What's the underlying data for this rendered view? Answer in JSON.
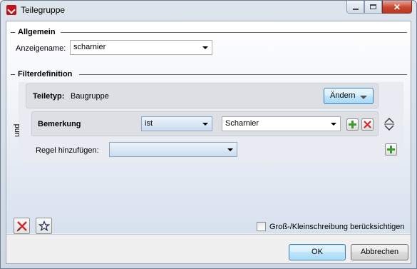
{
  "window": {
    "title": "Teilegruppe"
  },
  "allgemein": {
    "section_title": "Allgemein",
    "anzeigename_label": "Anzeigename:",
    "anzeigename_value": "scharnier"
  },
  "filter": {
    "section_title": "Filterdefinition",
    "connector_label": "und",
    "teiltyp_label": "Teiletyp:",
    "teiltyp_value": "Baugruppe",
    "aendern_label": "Ändern",
    "rule": {
      "field_label": "Bemerkung",
      "operator_value": "ist",
      "value": "Scharnier"
    },
    "add_rule_label": "Regel hinzufügen:",
    "add_rule_value": ""
  },
  "footer": {
    "case_sensitive_label": "Groß-/Kleinschreibung berücksichtigen",
    "case_sensitive_checked": false,
    "ok_label": "OK",
    "cancel_label": "Abbrechen"
  },
  "colors": {
    "accent_green": "#3f9a2f",
    "accent_red": "#d0262a"
  }
}
